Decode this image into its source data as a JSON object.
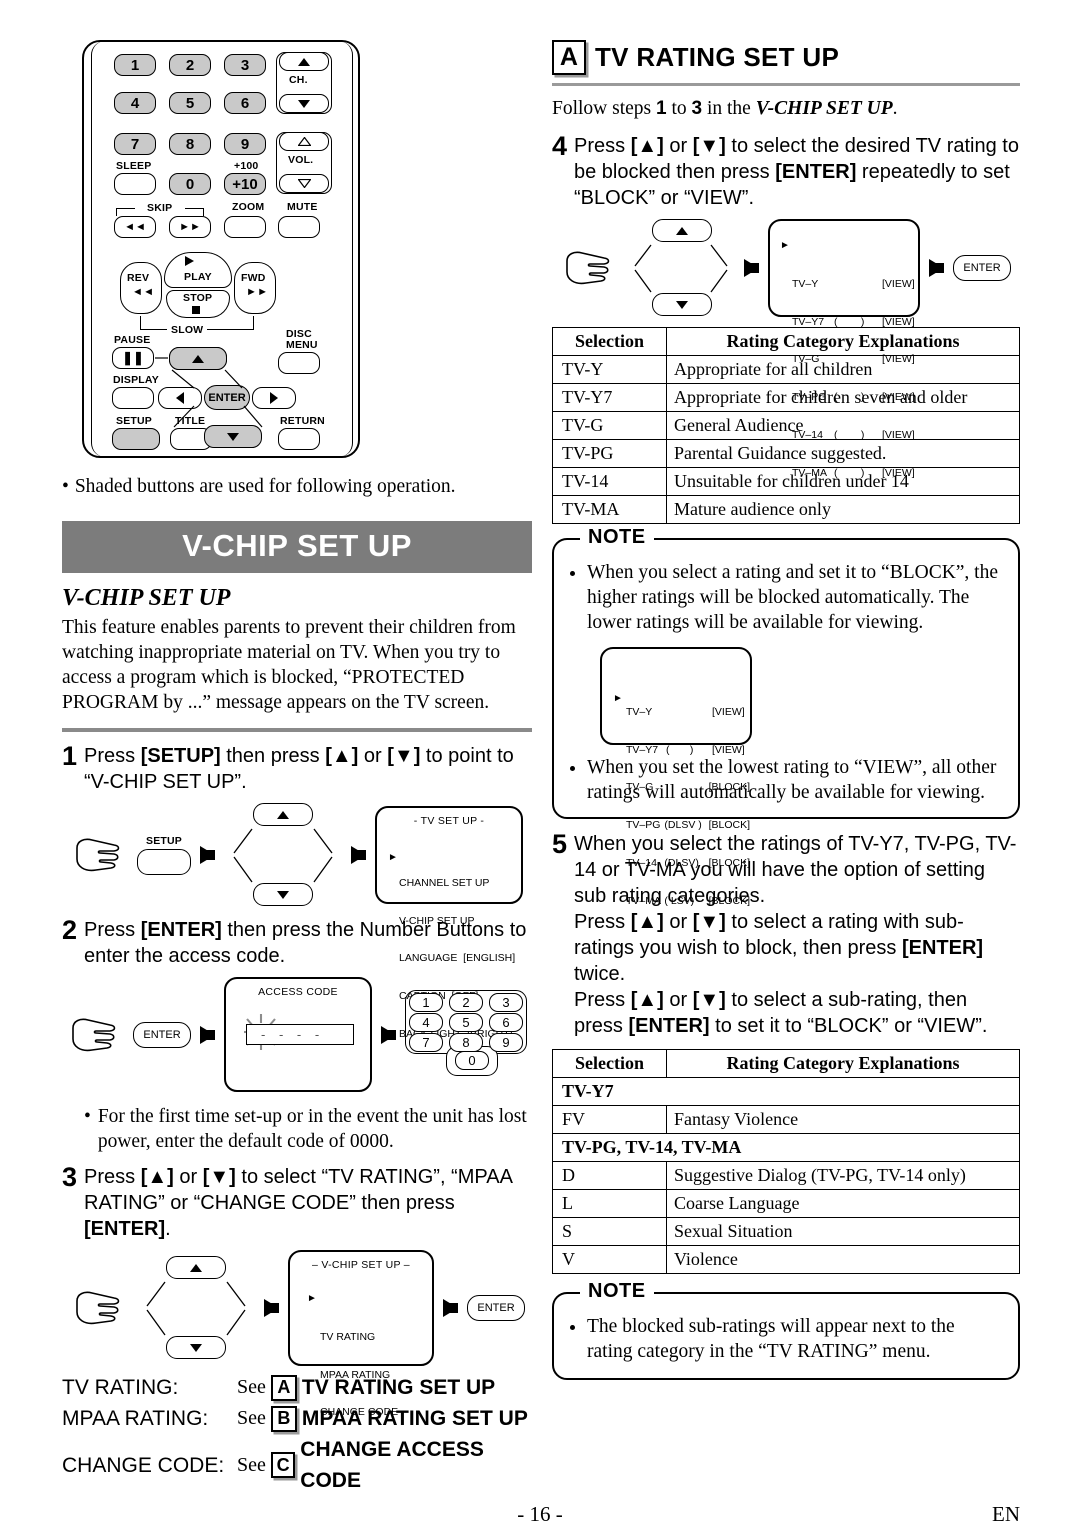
{
  "page": {
    "number": "- 16 -",
    "lang": "EN"
  },
  "remote": {
    "caption": "Shaded buttons are used for following operation.",
    "numbers": [
      "1",
      "2",
      "3",
      "4",
      "5",
      "6",
      "7",
      "8",
      "9"
    ],
    "zero": "0",
    "plus10": "+10",
    "plus100": "+100",
    "sleep": "SLEEP",
    "ch": "CH.",
    "vol": "VOL.",
    "skip": "SKIP",
    "zoom": "ZOOM",
    "mute": "MUTE",
    "play": "PLAY",
    "rev": "REV",
    "fwd": "FWD",
    "stop": "STOP",
    "slow": "SLOW",
    "pause": "PAUSE",
    "disc_menu_1": "DISC",
    "disc_menu_2": "MENU",
    "display": "DISPLAY",
    "setup": "SETUP",
    "title": "TITLE",
    "return": "RETURN",
    "enter": "ENTER"
  },
  "left": {
    "title_bar": "V-CHIP SET UP",
    "subhead": "V-CHIP SET UP",
    "intro": "This feature enables parents to prevent their children from watching inappropriate material on TV. When you try to access a program which is blocked, “PROTECTED PROGRAM by ...” message appears on the TV screen.",
    "steps": [
      {
        "n": "1",
        "text": "Press [SETUP] then press [▲] or [▼] to point to “V-CHIP SET UP”."
      },
      {
        "n": "2",
        "text": "Press [ENTER] then press the Number Buttons to enter the access code."
      },
      {
        "n": "3",
        "text": "Press [▲] or [▼] to select “TV RATING”, “MPAA RATING” or “CHANGE CODE” then press [ENTER]."
      }
    ],
    "screen_tvsetup": {
      "title": "- TV SET UP -",
      "items": [
        "CHANNEL SET UP",
        "V-CHIP SET UP",
        "LANGUAGE  [ENGLISH]",
        "CAPTION  [OFF]",
        "BACK LIGHT  [BRIGHT]"
      ],
      "cursor_index": 1
    },
    "screen_accesscode": {
      "title": "ACCESS CODE",
      "value": "- - - -"
    },
    "keypad": [
      "1",
      "2",
      "3",
      "4",
      "5",
      "6",
      "7",
      "8",
      "9",
      "0"
    ],
    "bullet_default_code": "For the first time set-up or in the event the unit has lost power, enter the default code of 0000.",
    "screen_vchip": {
      "title": "– V-CHIP SET UP –",
      "items": [
        "TV RATING",
        "MPAA RATING",
        "CHANGE CODE"
      ],
      "cursor_index": 0
    },
    "enter_label": "ENTER",
    "see_rows": [
      {
        "key": "TV RATING:",
        "see": "See",
        "badge": "A",
        "value": "TV RATING SET UP"
      },
      {
        "key": "MPAA RATING:",
        "see": "See",
        "badge": "B",
        "value": "MPAA RATING SET UP"
      },
      {
        "key": "CHANGE CODE:",
        "see": "See",
        "badge": "C",
        "value": "CHANGE ACCESS CODE"
      }
    ]
  },
  "right": {
    "badge": "A",
    "heading": "TV RATING SET UP",
    "follow": "Follow steps 1 to 3 in the V-CHIP SET UP.",
    "follow_parts": {
      "pre": "Follow steps",
      "one": "1",
      "mid": "to",
      "three": "3",
      "post": "in the",
      "ref": "V-CHIP SET UP",
      "end": "."
    },
    "step4": {
      "n": "4",
      "text": "Press [▲] or [▼] to select the desired TV rating to be blocked then press [ENTER] repeatedly to set “BLOCK” or “VIEW”."
    },
    "screen_rating": {
      "cursor_index": 0,
      "rows": [
        {
          "label": "TV–Y",
          "sub": "",
          "state": "[VIEW]"
        },
        {
          "label": "TV–Y7",
          "sub": "(        )",
          "state": "[VIEW]"
        },
        {
          "label": "TV–G",
          "sub": "",
          "state": "[VIEW]"
        },
        {
          "label": "TV–PG",
          "sub": "(        )",
          "state": "[VIEW]"
        },
        {
          "label": "TV–14",
          "sub": "(        )",
          "state": "[VIEW]"
        },
        {
          "label": "TV–MA",
          "sub": "(        )",
          "state": "[VIEW]"
        }
      ]
    },
    "enter_label": "ENTER",
    "table1": {
      "headers": [
        "Selection",
        "Rating Category Explanations"
      ],
      "rows": [
        [
          "TV-Y",
          "Appropriate for all children"
        ],
        [
          "TV-Y7",
          "Appropriate for children seven and older"
        ],
        [
          "TV-G",
          "General Audience"
        ],
        [
          "TV-PG",
          "Parental Guidance suggested."
        ],
        [
          "TV-14",
          "Unsuitable for children under 14"
        ],
        [
          "TV-MA",
          "Mature audience only"
        ]
      ]
    },
    "note1": {
      "label": "NOTE",
      "bullets": [
        "When you select a rating and set it to “BLOCK”, the higher ratings will be blocked automatically. The lower ratings will be available for viewing.",
        "When you set the lowest rating to “VIEW”, all other ratings will automatically be available for viewing."
      ],
      "screen": {
        "cursor_index": 2,
        "rows": [
          {
            "label": "TV–Y",
            "sub": "",
            "state": "[VIEW]"
          },
          {
            "label": "TV–Y7",
            "sub": "(       )",
            "state": "[VIEW]"
          },
          {
            "label": "TV–G",
            "sub": "",
            "state": "[BLOCK]"
          },
          {
            "label": "TV–PG",
            "sub": "(DLSV )",
            "state": "[BLOCK]"
          },
          {
            "label": "TV–14",
            "sub": "(DLSV)",
            "state": "[BLOCK]"
          },
          {
            "label": "TV–MA",
            "sub": "( LSV)",
            "state": "[BLOCK]"
          }
        ]
      }
    },
    "step5": {
      "n": "5",
      "p1": "When you select the ratings of TV-Y7, TV-PG, TV-14 or TV-MA you will have the option of setting sub rating categories.",
      "p2": "Press [▲] or [▼] to select a rating with sub-ratings you wish to block, then press [ENTER] twice.",
      "p3": "Press [▲] or [▼] to select a sub-rating, then press [ENTER] to set it to “BLOCK” or “VIEW”."
    },
    "table2": {
      "headers": [
        "Selection",
        "Rating Category Explanations"
      ],
      "rows": [
        {
          "type": "group",
          "label": "TV-Y7"
        },
        {
          "type": "item",
          "sel": "FV",
          "desc": "Fantasy Violence"
        },
        {
          "type": "group",
          "label": "TV-PG, TV-14, TV-MA"
        },
        {
          "type": "item",
          "sel": "D",
          "desc": "Suggestive Dialog    (TV-PG, TV-14 only)"
        },
        {
          "type": "item",
          "sel": "L",
          "desc": "Coarse Language"
        },
        {
          "type": "item",
          "sel": "S",
          "desc": "Sexual Situation"
        },
        {
          "type": "item",
          "sel": "V",
          "desc": "Violence"
        }
      ]
    },
    "note2": {
      "label": "NOTE",
      "bullets": [
        "The blocked sub-ratings will appear next to the rating category in the “TV RATING” menu."
      ]
    }
  },
  "colors": {
    "heading_bar": "#7c7c7c",
    "rule": "#8a8a8a",
    "shaded_button": "#c9c9c9"
  }
}
